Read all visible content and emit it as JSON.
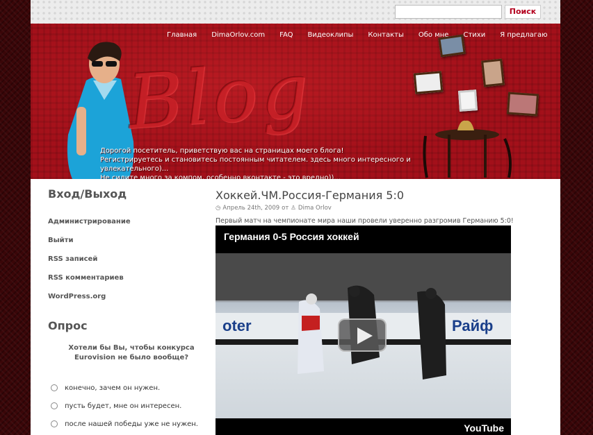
{
  "search": {
    "placeholder": "",
    "button_label": "Поиск"
  },
  "nav": {
    "items": [
      "Главная",
      "DimaOrlov.com",
      "FAQ",
      "Видеоклипы",
      "Контакты",
      "Обо мне",
      "Стихи",
      "Я предлагаю"
    ]
  },
  "header": {
    "logo_text": "Blog",
    "intro_lines": [
      "Дорогой посетитель, приветствую вас на страницах моего блога!",
      "Регистрируетесь и становитесь постоянным читателем. здесь много интересного и увлекательного)...",
      "Не сидите много за компом, особенно вконтакте - это вредно))..."
    ]
  },
  "sidebar": {
    "login_title": "Вход/Выход",
    "meta_links": [
      "Администрирование",
      "Выйти",
      "RSS записей",
      "RSS комментариев",
      "WordPress.org"
    ],
    "poll_title": "Опрос",
    "poll_question": "Хотели бы Вы, чтобы конкурса Eurovision не было вообще?",
    "poll_options": [
      "конечно, зачем он нужен.",
      "пусть будет, мне он интересен.",
      "после нашей победы уже не нужен."
    ]
  },
  "post": {
    "title": "Хоккей.ЧМ.Россия-Германия 5:0",
    "date": "Апрель 24th, 2009",
    "by": "от",
    "author": "Dima Orlov",
    "excerpt": "Первый матч на чемпионате мира наши провели уверенно разгромив Германию 5:0!",
    "video_title": "Германия 0-5 Россия хоккей",
    "video_brand": "YouTube"
  },
  "colors": {
    "header_red": "#a3101a",
    "accent": "#b3001e"
  }
}
